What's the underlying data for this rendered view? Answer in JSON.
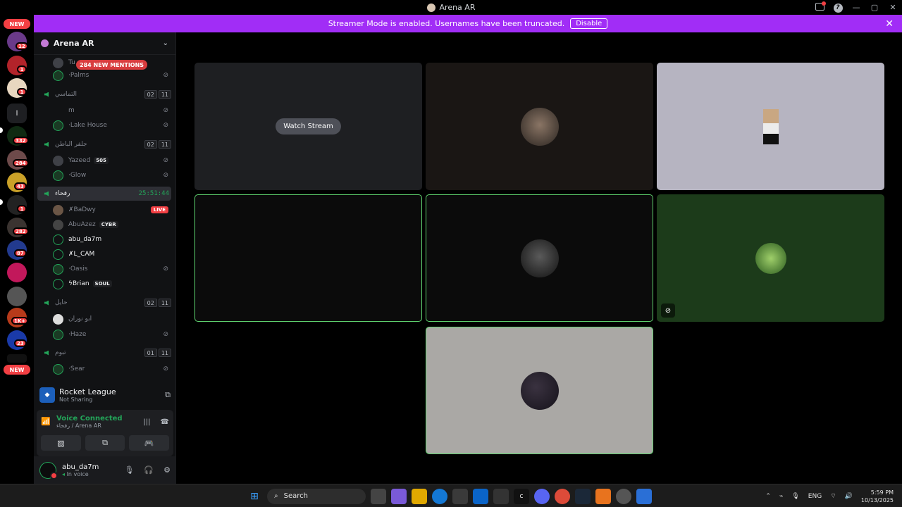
{
  "window": {
    "title": "Arena AR"
  },
  "banner": {
    "text": "Streamer Mode is enabled. Usernames have been truncated.",
    "disable_label": "Disable"
  },
  "rail": {
    "top_pill": "NEW",
    "bottom_pill": "NEW",
    "badges": [
      "12",
      "1",
      "1",
      "332",
      "284",
      "43",
      "1",
      "282",
      "87",
      "1K+",
      "23"
    ]
  },
  "server": {
    "name": "Arena AR",
    "mentions_pill": "284 NEW MENTIONS"
  },
  "channels": [
    {
      "name": "التماسي",
      "time": [
        "02",
        "11"
      ]
    },
    {
      "name": "جلفر الباطن",
      "time": [
        "02",
        "11"
      ]
    },
    {
      "name": "رفحاء",
      "timer": "25:51:44"
    },
    {
      "name": "حايل",
      "time": [
        "02",
        "11"
      ]
    },
    {
      "name": "تبوم",
      "time": [
        "01",
        "11"
      ]
    }
  ],
  "users": {
    "tu": "Tu",
    "palms": "Palms",
    "m": "m",
    "lake_house": "Lake House",
    "yazeed": "Yazeed",
    "yazeed_tag": "505",
    "glow": "Glow",
    "badwy": "BaDwy",
    "live": "LIVE",
    "abuazez": "AbuAzez",
    "abuazez_tag": "CYBR",
    "abu_da7m": "abu_da7m",
    "l_cam": "L_CAM",
    "oasis": "Oasis",
    "brian": "Brian",
    "brian_tag": "SOUL",
    "abu_nooran": "ابو نوران",
    "haze": "Haze",
    "sear": "Sear"
  },
  "activity": {
    "game": "Rocket League",
    "status": "Not Sharing"
  },
  "voice": {
    "status": "Voice Connected",
    "location": "رفحاء / Arena AR"
  },
  "self": {
    "name": "abu_da7m",
    "status": "In voice"
  },
  "stage": {
    "watch_label": "Watch Stream"
  },
  "taskbar": {
    "search": "Search",
    "lang": "ENG",
    "time": "5:59 PM",
    "date": "10/13/2025"
  }
}
